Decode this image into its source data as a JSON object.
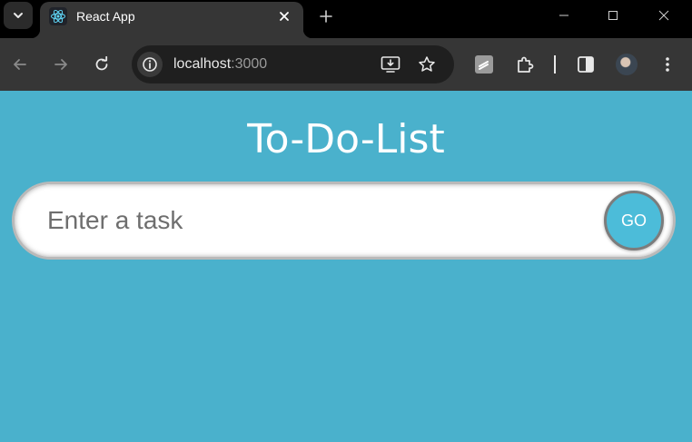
{
  "browser": {
    "tab": {
      "title": "React App",
      "favicon": "react-logo-icon",
      "close": "×"
    },
    "new_tab": "+",
    "address": {
      "host": "localhost",
      "port": ":3000"
    }
  },
  "app": {
    "title": "To-Do-List",
    "input": {
      "placeholder": "Enter a task",
      "value": ""
    },
    "submit_label": "GO"
  },
  "colors": {
    "page_background": "#4ab1cc",
    "go_button": "#4cbcd9",
    "tab_strip": "#000000",
    "toolbar": "#363636"
  }
}
